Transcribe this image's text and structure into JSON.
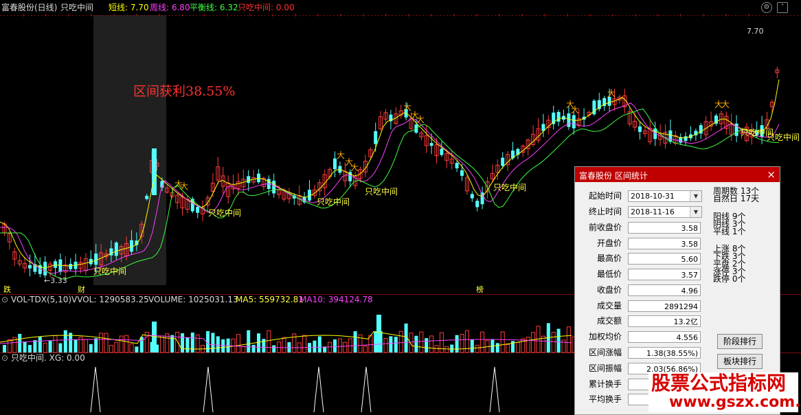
{
  "header": {
    "stock_name": "富春股份(日线)",
    "indicator_name": "只吃中间",
    "short_label": "短线: 7.70",
    "week_label": "周线: 6.80",
    "balance_label": "平衡线: 6.32",
    "signal_label": "只吃中间: 0.00",
    "colors": {
      "short": "#ffff00",
      "week": "#ff40ff",
      "balance": "#40ff40",
      "signal": "#ff3030"
    }
  },
  "main_chart": {
    "profit_annotation": "区间获利38.55%",
    "high_label": "7.70",
    "low_label": "←3.33",
    "signal_text": "只吃中间",
    "bottom_markers": [
      "跌",
      "财",
      "榜"
    ]
  },
  "volume_panel": {
    "title": "VOL-TDX(5,10)",
    "vvol": "VVOL: 1290583.25",
    "volume": "VOLUME: 1025031.13",
    "ma5": "MA5: 559732.81",
    "ma10": "MA10: 394124.78"
  },
  "indicator_panel": {
    "title": "只吃中间. XG: 0.00"
  },
  "dialog": {
    "title": "富春股份 区间统计",
    "start_label": "起始时间",
    "start_value": "2018-10-31",
    "end_label": "终止时间",
    "end_value": "2018-11-16",
    "rows": [
      {
        "label": "前收盘价",
        "value": "3.58"
      },
      {
        "label": "开盘价",
        "value": "3.58"
      },
      {
        "label": "最高价",
        "value": "5.60"
      },
      {
        "label": "最低价",
        "value": "3.57"
      },
      {
        "label": "收盘价",
        "value": "4.96"
      },
      {
        "label": "成交量",
        "value": "2891294"
      },
      {
        "label": "成交额",
        "value": "13.2亿"
      },
      {
        "label": "加权均价",
        "value": "4.556"
      },
      {
        "label": "区间涨幅",
        "value": "1.38(38.55%)"
      },
      {
        "label": "区间振幅",
        "value": "2.03(56.86%)"
      },
      {
        "label": "累计换手",
        "value": ""
      },
      {
        "label": "平均换手",
        "value": ""
      }
    ],
    "stats": [
      "周期数 13个",
      "自然日 17天",
      "阳线 9个",
      "阴线 3个",
      "平线 1个",
      "上涨 8个",
      "下跌 3个",
      "平盘 2个",
      "涨停 3个",
      "跌停 0个"
    ],
    "btn_stage": "阶段排行",
    "btn_sector": "板块排行"
  },
  "watermark": {
    "line1": "股票公式指标网",
    "line2": "www.gszx.com.cn"
  }
}
